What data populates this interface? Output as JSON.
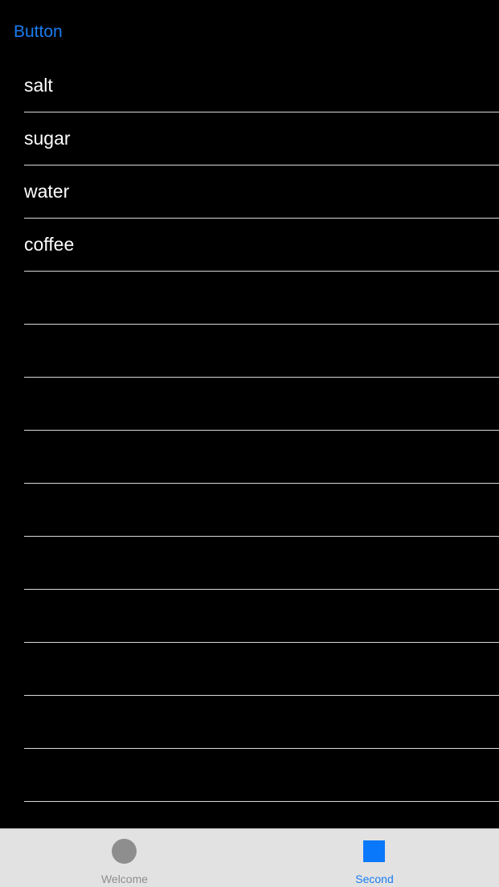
{
  "nav": {
    "button_label": "Button"
  },
  "list": {
    "items": [
      {
        "label": "salt"
      },
      {
        "label": "sugar"
      },
      {
        "label": "water"
      },
      {
        "label": "coffee"
      },
      {
        "label": ""
      },
      {
        "label": ""
      },
      {
        "label": ""
      },
      {
        "label": ""
      },
      {
        "label": ""
      },
      {
        "label": ""
      },
      {
        "label": ""
      },
      {
        "label": ""
      },
      {
        "label": ""
      },
      {
        "label": ""
      },
      {
        "label": ""
      }
    ]
  },
  "tabbar": {
    "tabs": [
      {
        "label": "Welcome",
        "icon": "circle-icon",
        "selected": false
      },
      {
        "label": "Second",
        "icon": "square-icon",
        "selected": true
      }
    ],
    "colors": {
      "selected": "#1a7cf0",
      "unselected": "#8e8e8e",
      "background": "#e2e2e2"
    }
  }
}
